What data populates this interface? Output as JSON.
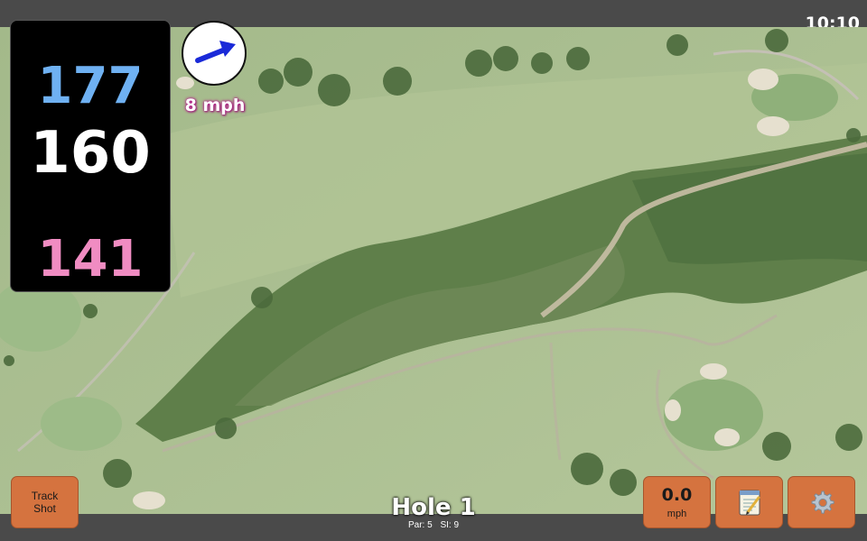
{
  "status_bar": {
    "time": "10:10"
  },
  "distances": {
    "back": "177",
    "middle": "160",
    "front": "141"
  },
  "wind": {
    "speed": "8 mph",
    "arrow_icon": "wind-arrow-icon"
  },
  "hole": {
    "title": "Hole 1",
    "par": "Par: 5",
    "stroke_index": "SI: 9"
  },
  "buttons": {
    "track_shot_line1": "Track",
    "track_shot_line2": "Shot",
    "speed_value": "0.0",
    "speed_unit": "mph",
    "notes_icon": "notepad-icon",
    "settings_icon": "gear-icon"
  },
  "colors": {
    "back_distance": "#6fb1f2",
    "middle_distance": "#ffffff",
    "front_distance": "#f08cc2",
    "button_orange": "#d5733f"
  }
}
